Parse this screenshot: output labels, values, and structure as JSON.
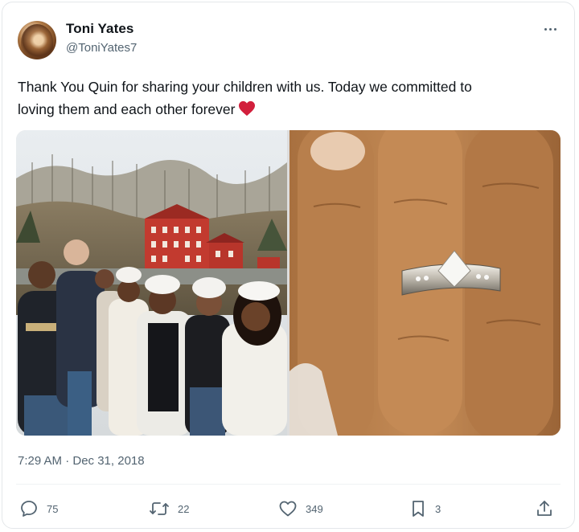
{
  "author": {
    "name": "Toni Yates",
    "handle": "@ToniYates7"
  },
  "tweet": {
    "text_line1": "Thank You Quin for sharing your children with us. Today we committed to",
    "text_line2": "loving them and each other forever",
    "emoji": "red-heart",
    "timestamp": "7:29 AM · Dec 31, 2018"
  },
  "media": [
    {
      "icon": "group-photo",
      "description_kind": "photo"
    },
    {
      "icon": "ring-photo",
      "description_kind": "photo"
    }
  ],
  "actions": {
    "replies": "75",
    "retweets": "22",
    "likes": "349",
    "bookmarks": "3"
  },
  "colors": {
    "text": "#0f1419",
    "secondary": "#536471",
    "heart": "#d21f3c"
  }
}
